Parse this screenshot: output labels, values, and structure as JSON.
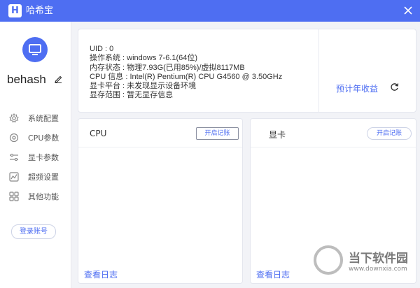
{
  "window": {
    "app_title": "哈希宝",
    "logo_letter": "H"
  },
  "sidebar": {
    "username": "behash",
    "menu": [
      {
        "label": "系统配置",
        "icon": "gear-icon"
      },
      {
        "label": "CPU参数",
        "icon": "cpu-gear-icon"
      },
      {
        "label": "显卡参数",
        "icon": "sliders-icon"
      },
      {
        "label": "超频设置",
        "icon": "chart-icon"
      },
      {
        "label": "其他功能",
        "icon": "grid-icon"
      }
    ],
    "login_label": "登录账号"
  },
  "info": {
    "uid": "UID : 0",
    "os": "操作系统 : windows 7-6.1(64位)",
    "memory": "内存状态 : 物理7.93G(已用85%)/虚拟8117MB",
    "cpu": "CPU 信息 : Intel(R) Pentium(R) CPU G4560 @ 3.50GHz",
    "gpu_platform": "显卡平台 : 未发现显示设备环境",
    "storage": "显存范围 : 暂无显存信息",
    "annual_label": "预计年收益"
  },
  "cards": {
    "cpu": {
      "title": "CPU",
      "record_label": "开启记账",
      "log_label": "查看日志"
    },
    "gpu": {
      "title": "显卡",
      "record_label": "开启记账",
      "log_label": "查看日志"
    }
  },
  "watermark": {
    "brand": "当下软件园",
    "url": "www.downxia.com"
  },
  "colors": {
    "accent": "#4e6ef2",
    "background": "#f2f3f7"
  }
}
